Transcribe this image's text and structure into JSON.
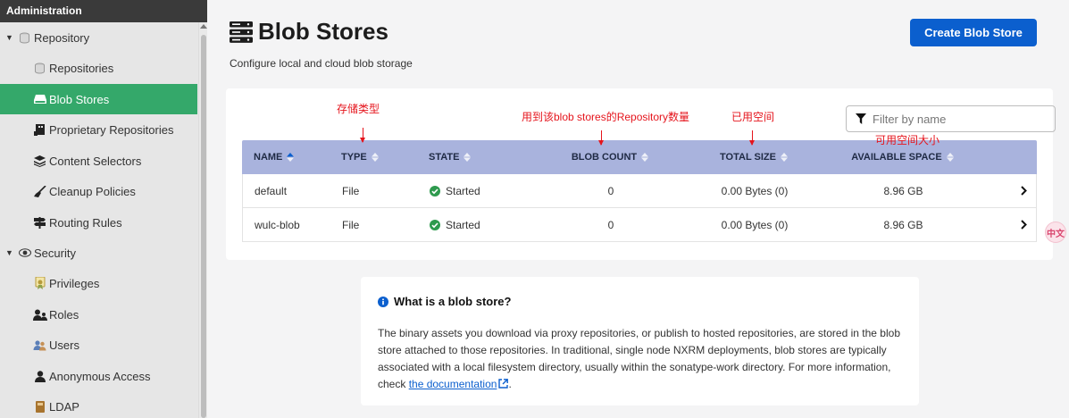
{
  "sidebar": {
    "header": "Administration",
    "items": [
      {
        "label": "Repository",
        "icon": "database-icon"
      },
      {
        "label": "Repositories",
        "icon": "database-icon"
      },
      {
        "label": "Blob Stores",
        "icon": "hard-drive-icon"
      },
      {
        "label": "Proprietary Repositories",
        "icon": "building-icon"
      },
      {
        "label": "Content Selectors",
        "icon": "layers-icon"
      },
      {
        "label": "Cleanup Policies",
        "icon": "broom-icon"
      },
      {
        "label": "Routing Rules",
        "icon": "signpost-icon"
      },
      {
        "label": "Security",
        "icon": "eye-icon"
      },
      {
        "label": "Privileges",
        "icon": "certificate-icon"
      },
      {
        "label": "Roles",
        "icon": "users-icon"
      },
      {
        "label": "Users",
        "icon": "user-group-icon"
      },
      {
        "label": "Anonymous Access",
        "icon": "user-icon"
      },
      {
        "label": "LDAP",
        "icon": "book-icon"
      }
    ]
  },
  "page": {
    "title": "Blob Stores",
    "subtitle": "Configure local and cloud blob storage",
    "create_button": "Create Blob Store"
  },
  "filter": {
    "placeholder": "Filter by name"
  },
  "table": {
    "headers": [
      "NAME",
      "TYPE",
      "STATE",
      "BLOB COUNT",
      "TOTAL SIZE",
      "AVAILABLE SPACE"
    ],
    "rows": [
      {
        "name": "default",
        "type": "File",
        "state": "Started",
        "blob_count": "0",
        "total_size": "0.00 Bytes (0)",
        "available_space": "8.96 GB"
      },
      {
        "name": "wulc-blob",
        "type": "File",
        "state": "Started",
        "blob_count": "0",
        "total_size": "0.00 Bytes (0)",
        "available_space": "8.96 GB"
      }
    ]
  },
  "annotations": {
    "type": "存储类型",
    "blob_count": "用到该blob stores的Repository数量",
    "total_size": "已用空间",
    "available_space": "可用空间大小"
  },
  "info": {
    "title": "What is a blob store?",
    "body": "The binary assets you download via proxy repositories, or publish to hosted repositories, are stored in the blob store attached to those repositories. In traditional, single node NXRM deployments, blob stores are typically associated with a local filesystem directory, usually within the sonatype-work directory. For more information, check ",
    "link": "the documentation",
    "tail": "."
  },
  "side_badge": "中文",
  "colors": {
    "accent": "#0b5fce",
    "active": "#34a86a",
    "header_bg": "#a9b3dd",
    "annotation": "#e5141c",
    "started": "#2e9a4e"
  }
}
